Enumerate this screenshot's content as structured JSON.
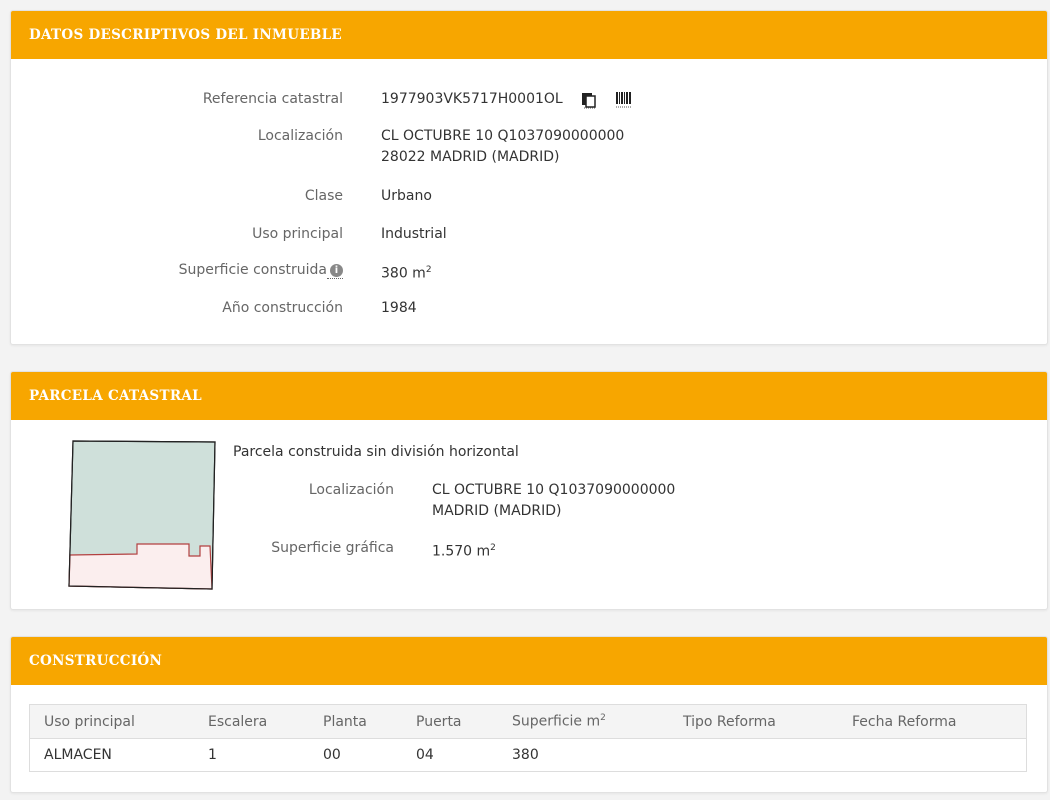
{
  "inmueble": {
    "title": "DATOS DESCRIPTIVOS DEL INMUEBLE",
    "ref_label": "Referencia catastral",
    "ref_value": "1977903VK5717H0001OL",
    "loc_label": "Localización",
    "loc_line1": "CL OCTUBRE 10 Q1037090000000",
    "loc_line2": "28022 MADRID (MADRID)",
    "clase_label": "Clase",
    "clase_value": "Urbano",
    "uso_label": "Uso principal",
    "uso_value": "Industrial",
    "sup_label": "Superficie construida",
    "sup_value": "380 m",
    "sup_unit_exp": "2",
    "anio_label": "Año construcción",
    "anio_value": "1984",
    "icons": [
      "copy-document-icon",
      "barcode-icon",
      "info-icon"
    ]
  },
  "parcela": {
    "title": "PARCELA CATASTRAL",
    "desc": "Parcela construida sin división horizontal",
    "loc_label": "Localización",
    "loc_line1": "CL OCTUBRE 10 Q1037090000000",
    "loc_line2": "MADRID (MADRID)",
    "sup_label": "Superficie gráfica",
    "sup_value": "1.570 m",
    "sup_unit_exp": "2",
    "colors": {
      "parcel_fill": "#cfe0da",
      "building_fill": "#fbeeee",
      "building_stroke": "#b24040"
    }
  },
  "construccion": {
    "title": "CONSTRUCCIÓN",
    "headers": [
      "Uso principal",
      "Escalera",
      "Planta",
      "Puerta",
      "Superficie m",
      "Tipo Reforma",
      "Fecha Reforma"
    ],
    "sup_header_exp": "2",
    "rows": [
      [
        "ALMACEN",
        "1",
        "00",
        "04",
        "380",
        "",
        ""
      ]
    ]
  },
  "colors": {
    "header_bg": "#f7a600",
    "header_text": "#ffffff"
  }
}
